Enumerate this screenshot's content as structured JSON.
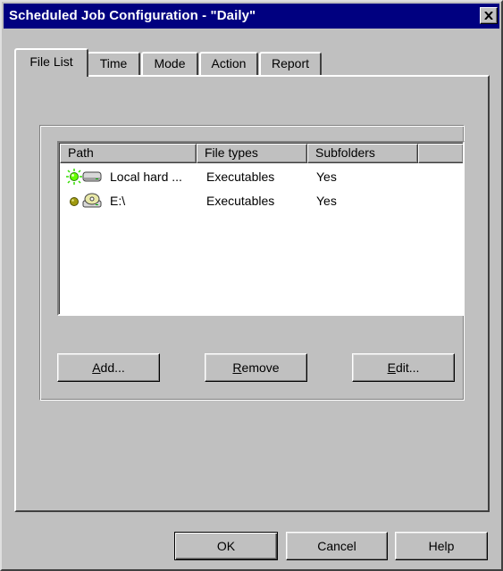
{
  "window": {
    "title": "Scheduled Job Configuration - \"Daily\"",
    "close_icon": "close-x-icon"
  },
  "tabs": [
    {
      "label": "File List",
      "active": true
    },
    {
      "label": "Time",
      "active": false
    },
    {
      "label": "Mode",
      "active": false
    },
    {
      "label": "Action",
      "active": false
    },
    {
      "label": "Report",
      "active": false
    }
  ],
  "file_list": {
    "columns": [
      "Path",
      "File types",
      "Subfolders"
    ],
    "rows": [
      {
        "icon": "status-active-bulb-icon",
        "type_icon": "hard-drive-icon",
        "path": "Local hard ...",
        "file_types": "Executables",
        "subfolders": "Yes"
      },
      {
        "icon": "status-inactive-dot-icon",
        "type_icon": "cd-drive-icon",
        "path": "E:\\",
        "file_types": "Executables",
        "subfolders": "Yes"
      }
    ]
  },
  "buttons": {
    "add": {
      "prefix": "",
      "accel": "A",
      "rest": "dd..."
    },
    "remove": {
      "prefix": "",
      "accel": "R",
      "rest": "emove"
    },
    "edit": {
      "prefix": "",
      "accel": "E",
      "rest": "dit..."
    },
    "ok": "OK",
    "cancel": "Cancel",
    "help": "Help"
  },
  "colors": {
    "titlebar": "#000080",
    "face": "#c0c0c0",
    "active_bulb": "#33dd00",
    "inactive_dot": "#999900"
  }
}
